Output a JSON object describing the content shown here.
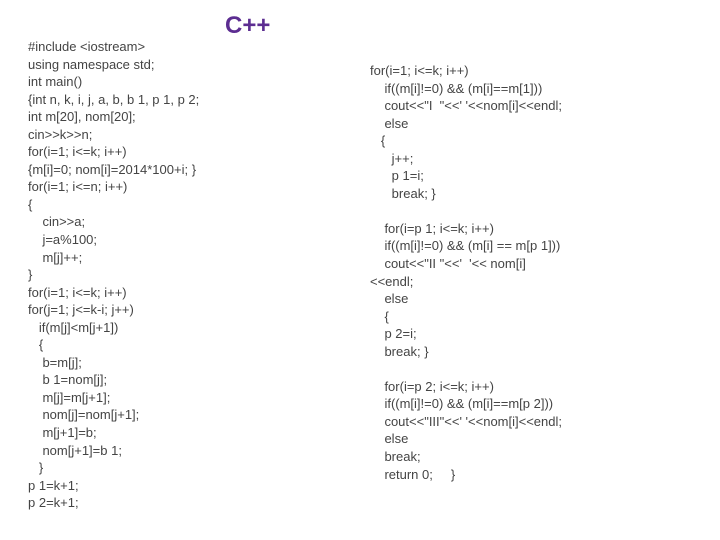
{
  "title": "C++",
  "left_code": "#include <iostream>\nusing namespace std;\nint main()\n{int n, k, i, j, a, b, b 1, p 1, p 2;\nint m[20], nom[20];\ncin>>k>>n;\nfor(i=1; i<=k; i++)\n{m[i]=0; nom[i]=2014*100+i; }\nfor(i=1; i<=n; i++)\n{\n    cin>>a;\n    j=a%100;\n    m[j]++;\n}\nfor(i=1; i<=k; i++)\nfor(j=1; j<=k-i; j++)\n   if(m[j]<m[j+1])\n   {\n    b=m[j];\n    b 1=nom[j];\n    m[j]=m[j+1];\n    nom[j]=nom[j+1];\n    m[j+1]=b;\n    nom[j+1]=b 1;\n   }\np 1=k+1;\np 2=k+1;",
  "right_code": "for(i=1; i<=k; i++)\n    if((m[i]!=0) && (m[i]==m[1]))\n    cout<<\"I  \"<<' '<<nom[i]<<endl;\n    else\n   {\n      j++;\n      p 1=i;\n      break; }\n\n    for(i=p 1; i<=k; i++)\n    if((m[i]!=0) && (m[i] == m[p 1]))\n    cout<<\"II \"<<'  '<< nom[i]\n<<endl;\n    else\n    {\n    p 2=i;\n    break; }\n\n    for(i=p 2; i<=k; i++)\n    if((m[i]!=0) && (m[i]==m[p 2]))\n    cout<<\"III\"<<' '<<nom[i]<<endl;\n    else\n    break;\n    return 0;     }"
}
